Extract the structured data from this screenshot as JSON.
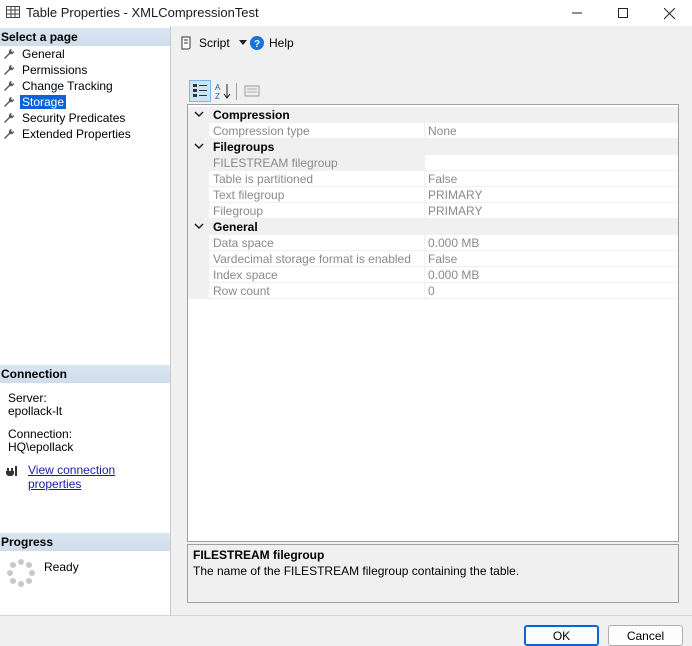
{
  "window": {
    "title": "Table Properties - XMLCompressionTest"
  },
  "sidebar": {
    "select_page_header": "Select a page",
    "pages": [
      {
        "label": "General"
      },
      {
        "label": "Permissions"
      },
      {
        "label": "Change Tracking"
      },
      {
        "label": "Storage",
        "selected": true
      },
      {
        "label": "Security Predicates"
      },
      {
        "label": "Extended Properties"
      }
    ],
    "connection_header": "Connection",
    "server_label": "Server:",
    "server_value": "epollack-lt",
    "connection_label": "Connection:",
    "connection_value": "HQ\\epollack",
    "connection_link": "View connection properties",
    "progress_header": "Progress",
    "progress_status": "Ready"
  },
  "toolbar": {
    "script_label": "Script",
    "help_label": "Help"
  },
  "property_grid": {
    "categories": [
      {
        "name": "Compression",
        "properties": [
          {
            "name": "Compression type",
            "value": "None"
          }
        ]
      },
      {
        "name": "Filegroups",
        "properties": [
          {
            "name": "FILESTREAM filegroup",
            "value": ""
          },
          {
            "name": "Table is partitioned",
            "value": "False"
          },
          {
            "name": "Text filegroup",
            "value": "PRIMARY"
          },
          {
            "name": "Filegroup",
            "value": "PRIMARY"
          }
        ]
      },
      {
        "name": "General",
        "properties": [
          {
            "name": "Data space",
            "value": "0.000 MB"
          },
          {
            "name": "Vardecimal storage format is enabled",
            "value": "False"
          },
          {
            "name": "Index space",
            "value": "0.000 MB"
          },
          {
            "name": "Row count",
            "value": "0"
          }
        ]
      }
    ],
    "selected_property": "FILESTREAM filegroup"
  },
  "description": {
    "title": "FILESTREAM filegroup",
    "text": "The name of the FILESTREAM filegroup containing the table."
  },
  "buttons": {
    "ok": "OK",
    "cancel": "Cancel"
  },
  "colors": {
    "accent": "#0a64d6",
    "section_header": "#d5e1ee",
    "disabled_text": "#8a8a8a"
  }
}
